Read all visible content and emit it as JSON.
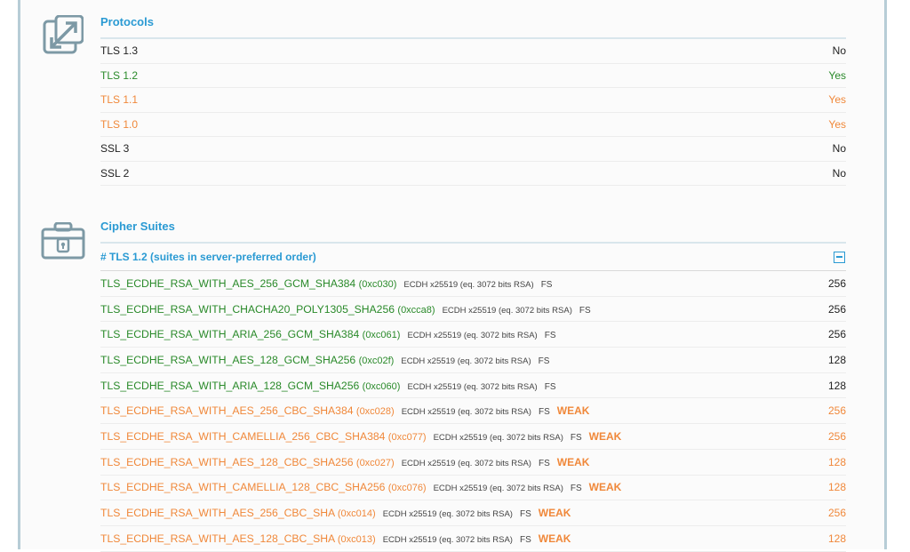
{
  "protocols": {
    "title": "Protocols",
    "rows": [
      {
        "name": "TLS 1.3",
        "value": "No",
        "status": "black"
      },
      {
        "name": "TLS 1.2",
        "value": "Yes",
        "status": "green"
      },
      {
        "name": "TLS 1.1",
        "value": "Yes",
        "status": "orange"
      },
      {
        "name": "TLS 1.0",
        "value": "Yes",
        "status": "orange"
      },
      {
        "name": "SSL 3",
        "value": "No",
        "status": "black"
      },
      {
        "name": "SSL 2",
        "value": "No",
        "status": "black"
      }
    ]
  },
  "cipher_suites": {
    "title": "Cipher Suites",
    "group_header": "# TLS 1.2 (suites in server-preferred order)",
    "rows": [
      {
        "name": "TLS_ECDHE_RSA_WITH_AES_256_GCM_SHA384",
        "code": "(0xc030)",
        "kex": "ECDH x25519 (eq. 3072 bits RSA)",
        "fs": "FS",
        "weak": "",
        "bits": "256",
        "status": "green"
      },
      {
        "name": "TLS_ECDHE_RSA_WITH_CHACHA20_POLY1305_SHA256",
        "code": "(0xcca8)",
        "kex": "ECDH x25519 (eq. 3072 bits RSA)",
        "fs": "FS",
        "weak": "",
        "bits": "256",
        "status": "green"
      },
      {
        "name": "TLS_ECDHE_RSA_WITH_ARIA_256_GCM_SHA384",
        "code": "(0xc061)",
        "kex": "ECDH x25519 (eq. 3072 bits RSA)",
        "fs": "FS",
        "weak": "",
        "bits": "256",
        "status": "green"
      },
      {
        "name": "TLS_ECDHE_RSA_WITH_AES_128_GCM_SHA256",
        "code": "(0xc02f)",
        "kex": "ECDH x25519 (eq. 3072 bits RSA)",
        "fs": "FS",
        "weak": "",
        "bits": "128",
        "status": "green"
      },
      {
        "name": "TLS_ECDHE_RSA_WITH_ARIA_128_GCM_SHA256",
        "code": "(0xc060)",
        "kex": "ECDH x25519 (eq. 3072 bits RSA)",
        "fs": "FS",
        "weak": "",
        "bits": "128",
        "status": "green"
      },
      {
        "name": "TLS_ECDHE_RSA_WITH_AES_256_CBC_SHA384",
        "code": "(0xc028)",
        "kex": "ECDH x25519 (eq. 3072 bits RSA)",
        "fs": "FS",
        "weak": "WEAK",
        "bits": "256",
        "status": "orange"
      },
      {
        "name": "TLS_ECDHE_RSA_WITH_CAMELLIA_256_CBC_SHA384",
        "code": "(0xc077)",
        "kex": "ECDH x25519 (eq. 3072 bits RSA)",
        "fs": "FS",
        "weak": "WEAK",
        "bits": "256",
        "status": "orange"
      },
      {
        "name": "TLS_ECDHE_RSA_WITH_AES_128_CBC_SHA256",
        "code": "(0xc027)",
        "kex": "ECDH x25519 (eq. 3072 bits RSA)",
        "fs": "FS",
        "weak": "WEAK",
        "bits": "128",
        "status": "orange"
      },
      {
        "name": "TLS_ECDHE_RSA_WITH_CAMELLIA_128_CBC_SHA256",
        "code": "(0xc076)",
        "kex": "ECDH x25519 (eq. 3072 bits RSA)",
        "fs": "FS",
        "weak": "WEAK",
        "bits": "128",
        "status": "orange"
      },
      {
        "name": "TLS_ECDHE_RSA_WITH_AES_256_CBC_SHA",
        "code": "(0xc014)",
        "kex": "ECDH x25519 (eq. 3072 bits RSA)",
        "fs": "FS",
        "weak": "WEAK",
        "bits": "256",
        "status": "orange"
      },
      {
        "name": "TLS_ECDHE_RSA_WITH_AES_128_CBC_SHA",
        "code": "(0xc013)",
        "kex": "ECDH x25519 (eq. 3072 bits RSA)",
        "fs": "FS",
        "weak": "WEAK",
        "bits": "128",
        "status": "orange"
      }
    ]
  },
  "icons": {
    "protocols": "expand-arrows-icon",
    "cipher_suites": "lock-briefcase-icon",
    "toggle": "collapse-minus-icon"
  },
  "colors": {
    "accent": "#2a9ad3",
    "good": "#2a8a2a",
    "weak": "#f0883a",
    "neutral": "#222222"
  }
}
